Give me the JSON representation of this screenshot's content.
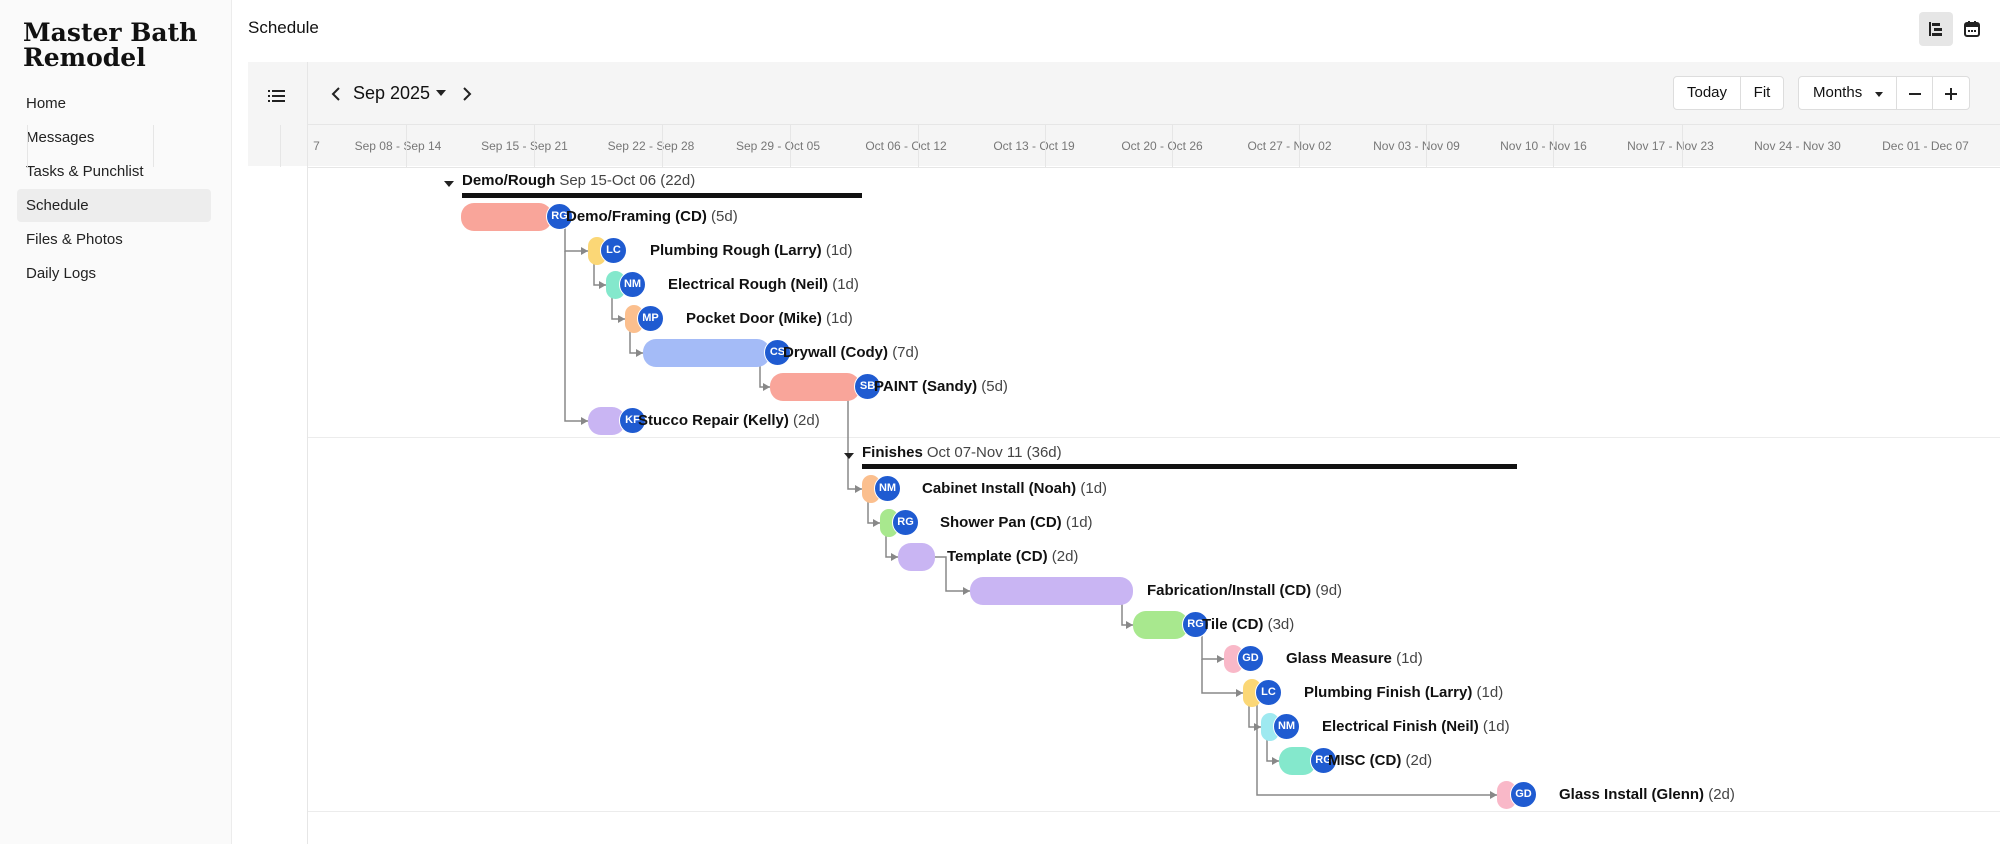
{
  "project": {
    "title": "Master Bath Remodel"
  },
  "nav": {
    "items": [
      {
        "label": "Home"
      },
      {
        "label": "Messages"
      },
      {
        "label": "Tasks & Punchlist"
      },
      {
        "label": "Schedule",
        "active": true
      },
      {
        "label": "Files & Photos"
      },
      {
        "label": "Daily Logs"
      }
    ]
  },
  "page": {
    "title": "Schedule"
  },
  "toolbar": {
    "month_label": "Sep 2025",
    "today_label": "Today",
    "fit_label": "Fit",
    "zoom_label": "Months"
  },
  "weeks": [
    "7",
    "Sep 08 - Sep 14",
    "Sep 15 - Sep 21",
    "Sep 22 - Sep 28",
    "Sep 29 - Oct 05",
    "Oct 06 - Oct 12",
    "Oct 13 - Oct 19",
    "Oct 20 - Oct 26",
    "Oct 27 - Nov 02",
    "Nov 03 - Nov 09",
    "Nov 10 - Nov 16",
    "Nov 17 - Nov 23",
    "Nov 24 - Nov 30",
    "Dec 01 - Dec 07"
  ],
  "groups": [
    {
      "name": "Demo/Rough",
      "meta": "Sep 15-Oct 06 (22d)"
    },
    {
      "name": "Finishes",
      "meta": "Oct 07-Nov 11 (36d)"
    }
  ],
  "tasks": [
    {
      "name": "Demo/Framing (CD)",
      "dur": "(5d)",
      "initials": "RG",
      "color": "#f9a59a"
    },
    {
      "name": "Plumbing Rough (Larry)",
      "dur": "(1d)",
      "initials": "LC",
      "color": "#fbd776"
    },
    {
      "name": "Electrical Rough (Neil)",
      "dur": "(1d)",
      "initials": "NM",
      "color": "#84e8cc"
    },
    {
      "name": "Pocket Door (Mike)",
      "dur": "(1d)",
      "initials": "MP",
      "color": "#fbbf8e"
    },
    {
      "name": "Drywall (Cody)",
      "dur": "(7d)",
      "initials": "CS",
      "color": "#a4bbf7"
    },
    {
      "name": "PAINT (Sandy)",
      "dur": "(5d)",
      "initials": "SB",
      "color": "#f9a59a"
    },
    {
      "name": "Stucco Repair (Kelly)",
      "dur": "(2d)",
      "initials": "KF",
      "color": "#c9b5f3"
    },
    {
      "name": "Cabinet Install (Noah)",
      "dur": "(1d)",
      "initials": "NM",
      "color": "#fbbf8e"
    },
    {
      "name": "Shower Pan (CD)",
      "dur": "(1d)",
      "initials": "RG",
      "color": "#a8e88e"
    },
    {
      "name": "Template (CD)",
      "dur": "(2d)",
      "initials": "",
      "color": "#c9b5f3"
    },
    {
      "name": "Fabrication/Install (CD)",
      "dur": "(9d)",
      "initials": "",
      "color": "#c9b5f3"
    },
    {
      "name": "Tile (CD)",
      "dur": "(3d)",
      "initials": "RG",
      "color": "#a8e88e"
    },
    {
      "name": "Glass Measure",
      "dur": "(1d)",
      "initials": "GD",
      "color": "#f9b8c8"
    },
    {
      "name": "Plumbing Finish (Larry)",
      "dur": "(1d)",
      "initials": "LC",
      "color": "#fbd776"
    },
    {
      "name": "Electrical Finish (Neil)",
      "dur": "(1d)",
      "initials": "NM",
      "color": "#9ee9f0"
    },
    {
      "name": "MISC (CD)",
      "dur": "(2d)",
      "initials": "RG",
      "color": "#84e8cc"
    },
    {
      "name": "Glass Install (Glenn)",
      "dur": "(2d)",
      "initials": "GD",
      "color": "#f9b8c8"
    }
  ]
}
